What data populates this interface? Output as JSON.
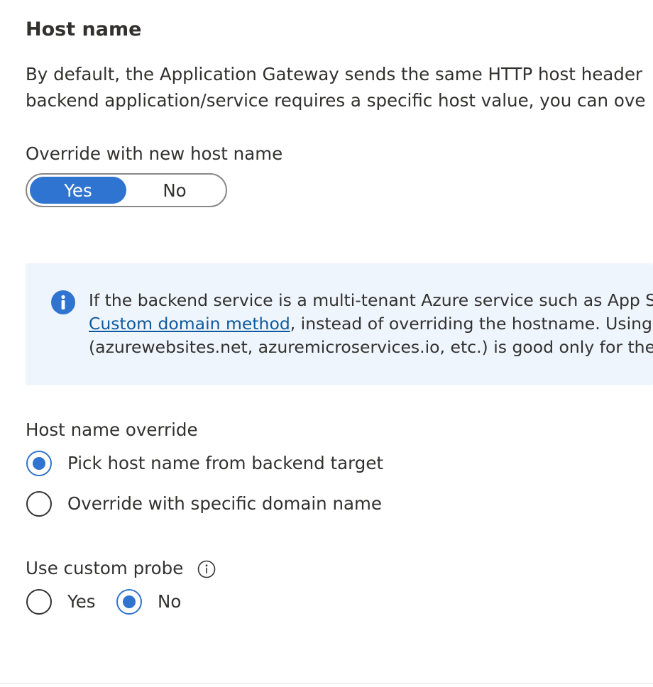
{
  "section": {
    "title": "Host name",
    "description_lines": [
      "By default, the Application Gateway sends the same HTTP host header",
      "backend application/service requires a specific host value, you can ove"
    ]
  },
  "override_toggle": {
    "label": "Override with new host name",
    "options": [
      "Yes",
      "No"
    ],
    "selected": "Yes"
  },
  "infobox": {
    "icon": "info-icon",
    "line1": "If the backend service is a multi-tenant Azure service such as App Se",
    "link_text": "Custom domain method",
    "line2_rest": ", instead of overriding the hostname. Using",
    "line3": "(azurewebsites.net, azuremicroservices.io, etc.) is good only for the b",
    "accent_color": "#2f74d0",
    "background": "#eff5fc"
  },
  "host_name_override": {
    "label": "Host name override",
    "options": [
      {
        "label": "Pick host name from backend target",
        "checked": true
      },
      {
        "label": "Override with specific domain name",
        "checked": false
      }
    ]
  },
  "custom_probe": {
    "label": "Use custom probe",
    "info_icon": "info-circle-icon",
    "options": [
      {
        "label": "Yes",
        "checked": false
      },
      {
        "label": "No",
        "checked": true
      }
    ]
  }
}
